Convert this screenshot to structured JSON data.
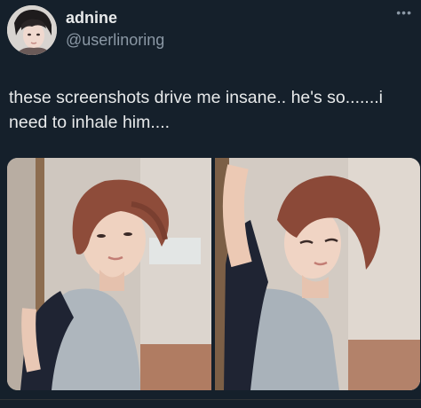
{
  "tweet": {
    "display_name": "adnine",
    "handle": "@userlinoring",
    "text": "these screenshots drive me insane.. he's so.......i need to inhale him....",
    "more_icon": "more-options-icon"
  },
  "media": {
    "count": 2,
    "photos": [
      {
        "name": "photo-left"
      },
      {
        "name": "photo-right"
      }
    ]
  }
}
